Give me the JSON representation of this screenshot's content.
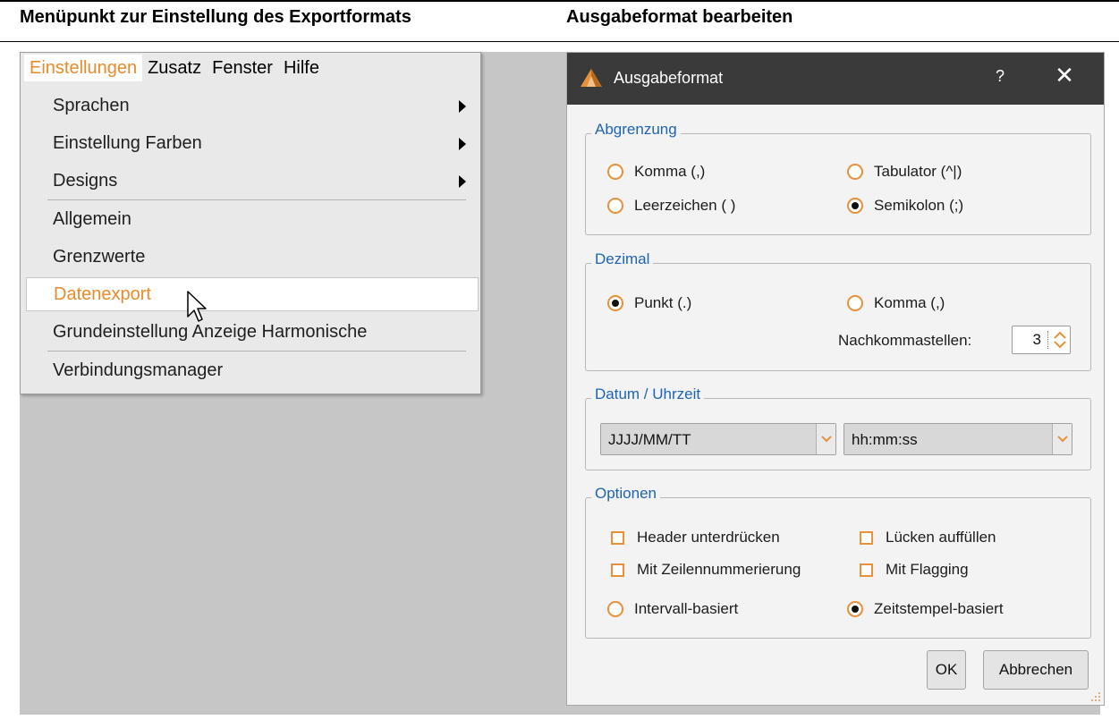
{
  "captions": {
    "left": "Menüpunkt zur Einstellung des Exportformats",
    "right": "Ausgabeformat bearbeiten"
  },
  "menubar": {
    "items": [
      "Einstellungen",
      "Zusatz",
      "Fenster",
      "Hilfe"
    ],
    "active_index": 0
  },
  "menu": {
    "items": [
      {
        "label": "Sprachen",
        "submenu": true
      },
      {
        "label": "Einstellung Farben",
        "submenu": true
      },
      {
        "label": "Designs",
        "submenu": true
      },
      {
        "label": "Allgemein",
        "submenu": false
      },
      {
        "label": "Grenzwerte",
        "submenu": false
      },
      {
        "label": "Datenexport",
        "submenu": false,
        "highlighted": true
      },
      {
        "label": "Grundeinstellung Anzeige Harmonische",
        "submenu": false
      },
      {
        "label": "Verbindungsmanager",
        "submenu": false
      }
    ]
  },
  "dialog": {
    "title": "Ausgabeformat",
    "help": "?",
    "close": "✕",
    "abgrenzung": {
      "title": "Abgrenzung",
      "options": [
        {
          "label": "Komma (,)",
          "checked": false
        },
        {
          "label": "Tabulator (^|)",
          "checked": false
        },
        {
          "label": "Leerzeichen ( )",
          "checked": false
        },
        {
          "label": "Semikolon (;)",
          "checked": true
        }
      ]
    },
    "dezimal": {
      "title": "Dezimal",
      "options": [
        {
          "label": "Punkt (.)",
          "checked": true
        },
        {
          "label": "Komma (,)",
          "checked": false
        }
      ],
      "nachkomma_label": "Nachkommastellen:",
      "nachkomma_value": "3"
    },
    "datum": {
      "title": "Datum / Uhrzeit",
      "date_format": "JJJJ/MM/TT",
      "time_format": "hh:mm:ss"
    },
    "optionen": {
      "title": "Optionen",
      "checkboxes": [
        {
          "label": "Header unterdrücken",
          "checked": false
        },
        {
          "label": "Lücken auffüllen",
          "checked": false
        },
        {
          "label": "Mit Zeilennummerierung",
          "checked": false
        },
        {
          "label": "Mit Flagging",
          "checked": false
        }
      ],
      "radios": [
        {
          "label": "Intervall-basiert",
          "checked": false
        },
        {
          "label": "Zeitstempel-basiert",
          "checked": true
        }
      ]
    },
    "buttons": {
      "ok": "OK",
      "cancel": "Abbrechen"
    }
  },
  "colors": {
    "accent": "#ea8a2a",
    "group_title": "#1e64b4",
    "titlebar": "#3a3a3a",
    "panel_gray": "#c6c6c6"
  }
}
